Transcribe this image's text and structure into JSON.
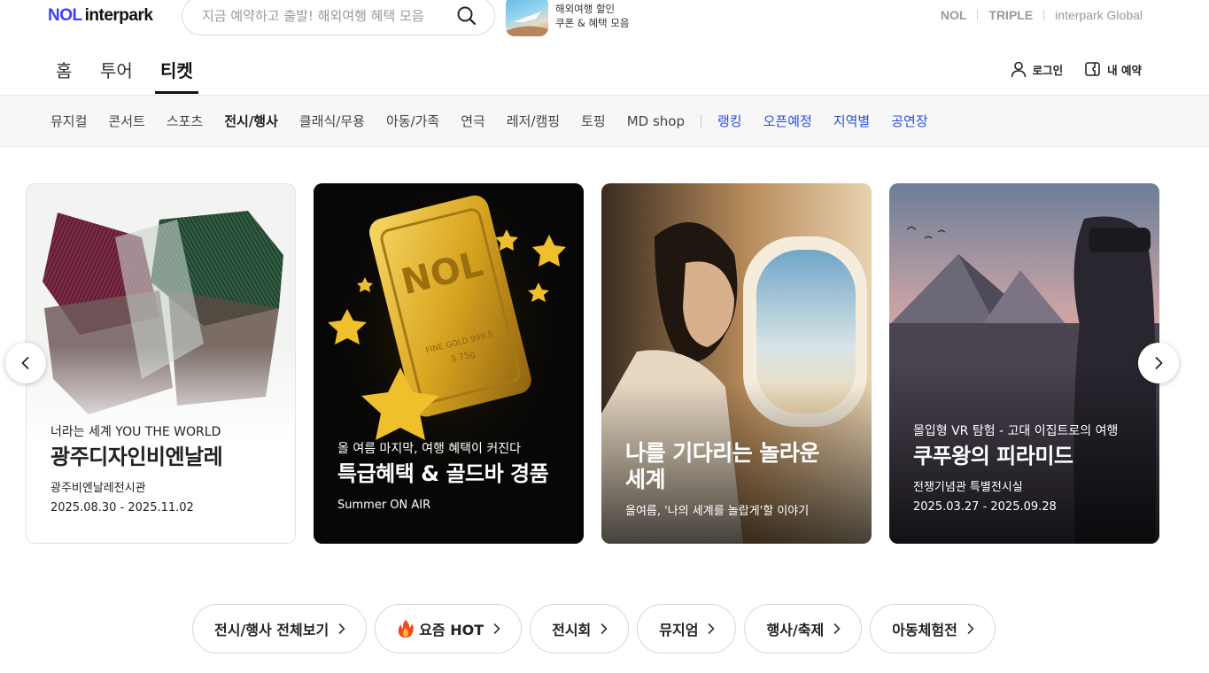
{
  "header": {
    "logo_nol": "NOL",
    "logo_interpark": "interpark",
    "search_placeholder": "지금 예약하고 출발! 해외여행 혜택 모음",
    "promo": {
      "line1": "해외여행 할인",
      "line2": "쿠폰 & 혜택 모음"
    },
    "ext_links": [
      "NOL",
      "TRIPLE",
      "interpark Global"
    ]
  },
  "main_nav": {
    "tabs": [
      {
        "label": "홈",
        "active": false
      },
      {
        "label": "투어",
        "active": false
      },
      {
        "label": "티켓",
        "active": true
      }
    ],
    "login_label": "로그인",
    "my_booking_label": "내 예약"
  },
  "categories": {
    "items": [
      "뮤지컬",
      "콘서트",
      "스포츠",
      "전시/행사",
      "클래식/무용",
      "아동/가족",
      "연극",
      "레저/캠핑",
      "토핑",
      "MD shop"
    ],
    "active": "전시/행사",
    "blue_items": [
      "랭킹",
      "오픈예정",
      "지역별",
      "공연장"
    ]
  },
  "banners": [
    {
      "sub": "너라는 세계 YOU THE WORLD",
      "title": "광주디자인비엔날레",
      "meta1": "광주비엔날레전시관",
      "meta2": "2025.08.30 - 2025.11.02"
    },
    {
      "sub": "올 여름 마지막, 여행 혜택이 커진다",
      "title": "특급혜택 & 골드바 경품",
      "meta1": "Summer ON AIR",
      "gold_bar_text": "NOL",
      "gold_bar_fine": "FINE GOLD 999.9",
      "gold_bar_weight": "3.75g"
    },
    {
      "title_line1": "나를 기다리는 놀라운",
      "title_line2": "세계",
      "meta1": "올여름, '나의 세계를 놀랍게'할 이야기"
    },
    {
      "sub": "몰입형 VR 탐험 - 고대 이집트로의 여행",
      "title": "쿠푸왕의 피라미드",
      "meta1": "전쟁기념관 특별전시실",
      "meta2": "2025.03.27 - 2025.09.28"
    }
  ],
  "pills": [
    {
      "label": "전시/행사 전체보기",
      "icon": ""
    },
    {
      "label": "요즘 HOT",
      "icon": "fire-icon"
    },
    {
      "label": "전시회",
      "icon": ""
    },
    {
      "label": "뮤지엄",
      "icon": ""
    },
    {
      "label": "행사/축제",
      "icon": ""
    },
    {
      "label": "아동체험전",
      "icon": ""
    }
  ],
  "colors": {
    "brand_blue": "#3d3dff",
    "link_blue": "#2b50e0",
    "text": "#222222"
  }
}
